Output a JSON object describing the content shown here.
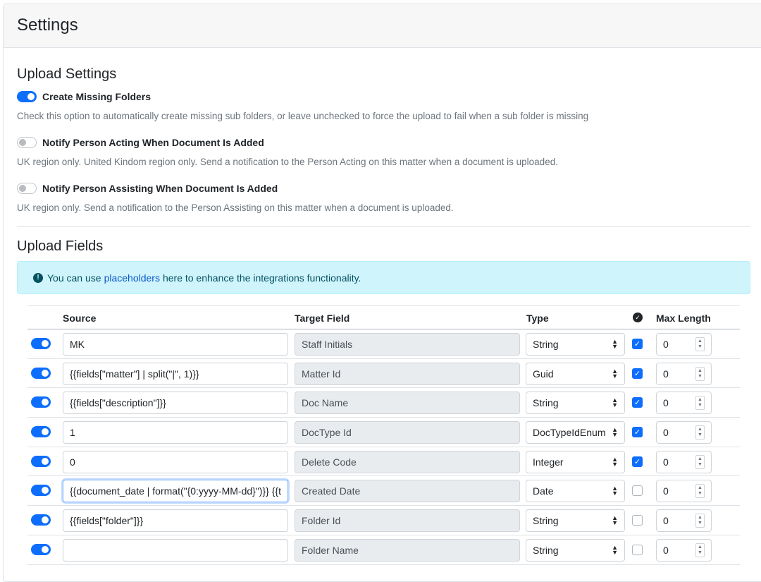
{
  "header": {
    "title": "Settings"
  },
  "upload_settings": {
    "heading": "Upload Settings",
    "options": [
      {
        "label": "Create Missing Folders",
        "enabled": true,
        "description": "Check this option to automatically create missing sub folders, or leave unchecked to force the upload to fail when a sub folder is missing"
      },
      {
        "label": "Notify Person Acting When Document Is Added",
        "enabled": false,
        "description": "UK region only. United Kindom region only. Send a notification to the Person Acting on this matter when a document is uploaded."
      },
      {
        "label": "Notify Person Assisting When Document Is Added",
        "enabled": false,
        "description": "UK region only. Send a notification to the Person Assisting on this matter when a document is uploaded."
      }
    ]
  },
  "upload_fields": {
    "heading": "Upload Fields",
    "alert": {
      "prefix": "You can use",
      "link": "placeholders",
      "suffix": "here to enhance the integrations functionality."
    },
    "columns": {
      "source": "Source",
      "target": "Target Field",
      "type": "Type",
      "required_icon": "check-circle-icon",
      "max_length": "Max Length"
    },
    "rows": [
      {
        "enabled": true,
        "source": "MK",
        "target": "Staff Initials",
        "type": "String",
        "required": true,
        "max_length": "0"
      },
      {
        "enabled": true,
        "source": "{{fields[\"matter\"] | split(\"|\", 1)}}",
        "target": "Matter Id",
        "type": "Guid",
        "required": true,
        "max_length": "0"
      },
      {
        "enabled": true,
        "source": "{{fields[\"description\"]}}",
        "target": "Doc Name",
        "type": "String",
        "required": true,
        "max_length": "0"
      },
      {
        "enabled": true,
        "source": "1",
        "target": "DocType Id",
        "type": "DocTypeIdEnum",
        "required": true,
        "max_length": "0"
      },
      {
        "enabled": true,
        "source": "0",
        "target": "Delete Code",
        "type": "Integer",
        "required": true,
        "max_length": "0"
      },
      {
        "enabled": true,
        "source": "{{document_date | format(\"{0:yyyy-MM-dd}\")}} {{t",
        "target": "Created Date",
        "type": "Date",
        "required": false,
        "max_length": "0",
        "focused": true
      },
      {
        "enabled": true,
        "source": "{{fields[\"folder\"]}}",
        "target": "Folder Id",
        "type": "String",
        "required": false,
        "max_length": "0"
      },
      {
        "enabled": true,
        "source": "",
        "target": "Folder Name",
        "type": "String",
        "required": false,
        "max_length": "0"
      }
    ]
  },
  "colors": {
    "accent": "#0d6efd",
    "alert_bg": "#cff4fc",
    "alert_text": "#055160"
  }
}
